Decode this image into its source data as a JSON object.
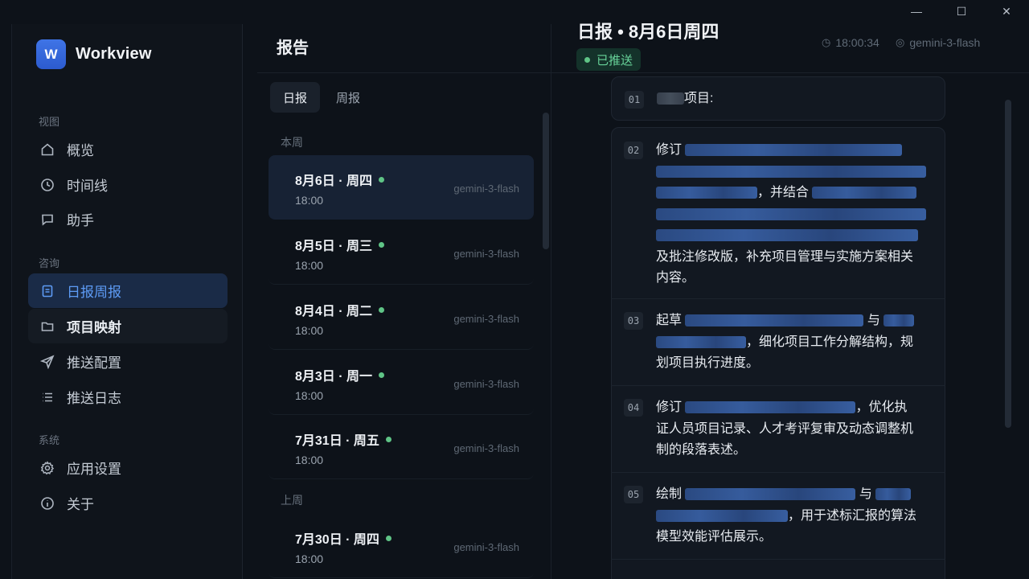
{
  "window": {
    "minimize": "—",
    "maximize": "☐",
    "close": "✕"
  },
  "app": {
    "logo_letter": "W",
    "name": "Workview"
  },
  "sidebar": {
    "sections": [
      {
        "label": "视图"
      },
      {
        "label": "咨询"
      },
      {
        "label": "系统"
      }
    ],
    "items": [
      {
        "label": "概览",
        "icon": "home-icon"
      },
      {
        "label": "时间线",
        "icon": "clock-icon"
      },
      {
        "label": "助手",
        "icon": "chat-icon"
      },
      {
        "label": "日报周报",
        "icon": "document-icon",
        "active": true
      },
      {
        "label": "项目映射",
        "icon": "folder-icon"
      },
      {
        "label": "推送配置",
        "icon": "send-icon"
      },
      {
        "label": "推送日志",
        "icon": "list-icon"
      },
      {
        "label": "应用设置",
        "icon": "gear-icon"
      },
      {
        "label": "关于",
        "icon": "info-icon"
      }
    ]
  },
  "list": {
    "title": "报告",
    "tabs": [
      {
        "label": "日报",
        "active": true
      },
      {
        "label": "周报"
      }
    ],
    "groups": {
      "this_week": "本周",
      "last_week": "上周"
    },
    "reports": [
      {
        "date": "8月6日 · 周四",
        "time": "18:00",
        "model": "gemini-3-flash",
        "active": true
      },
      {
        "date": "8月5日 · 周三",
        "time": "18:00",
        "model": "gemini-3-flash"
      },
      {
        "date": "8月4日 · 周二",
        "time": "18:00",
        "model": "gemini-3-flash"
      },
      {
        "date": "8月3日 · 周一",
        "time": "18:00",
        "model": "gemini-3-flash"
      },
      {
        "date": "7月31日 · 周五",
        "time": "18:00",
        "model": "gemini-3-flash"
      },
      {
        "date": "7月30日 · 周四",
        "time": "18:00",
        "model": "gemini-3-flash"
      }
    ]
  },
  "detail": {
    "title": "日报 • 8月6日周四",
    "status": "已推送",
    "time": "18:00:34",
    "model": "gemini-3-flash",
    "items": [
      {
        "num": "01",
        "t1": "项目:"
      },
      {
        "num": "02",
        "t1": "修订",
        "t2": "，并结合",
        "t3": "及批注修改版，补充项目管理与实施方案相关",
        "t4": "内容。"
      },
      {
        "num": "03",
        "t1": "起草",
        "t2": "与",
        "t3": "，细化项目工作分解结构，规",
        "t4": "划项目执行进度。"
      },
      {
        "num": "04",
        "t1": "修订",
        "t2": "，优化执",
        "t3": "证人员项目记录、人才考评复审及动态调整机",
        "t4": "制的段落表述。"
      },
      {
        "num": "05",
        "t1": "绘制",
        "t2": "与",
        "t3": "，用于述标汇报的算法",
        "t4": "模型效能评估展示。"
      }
    ]
  }
}
